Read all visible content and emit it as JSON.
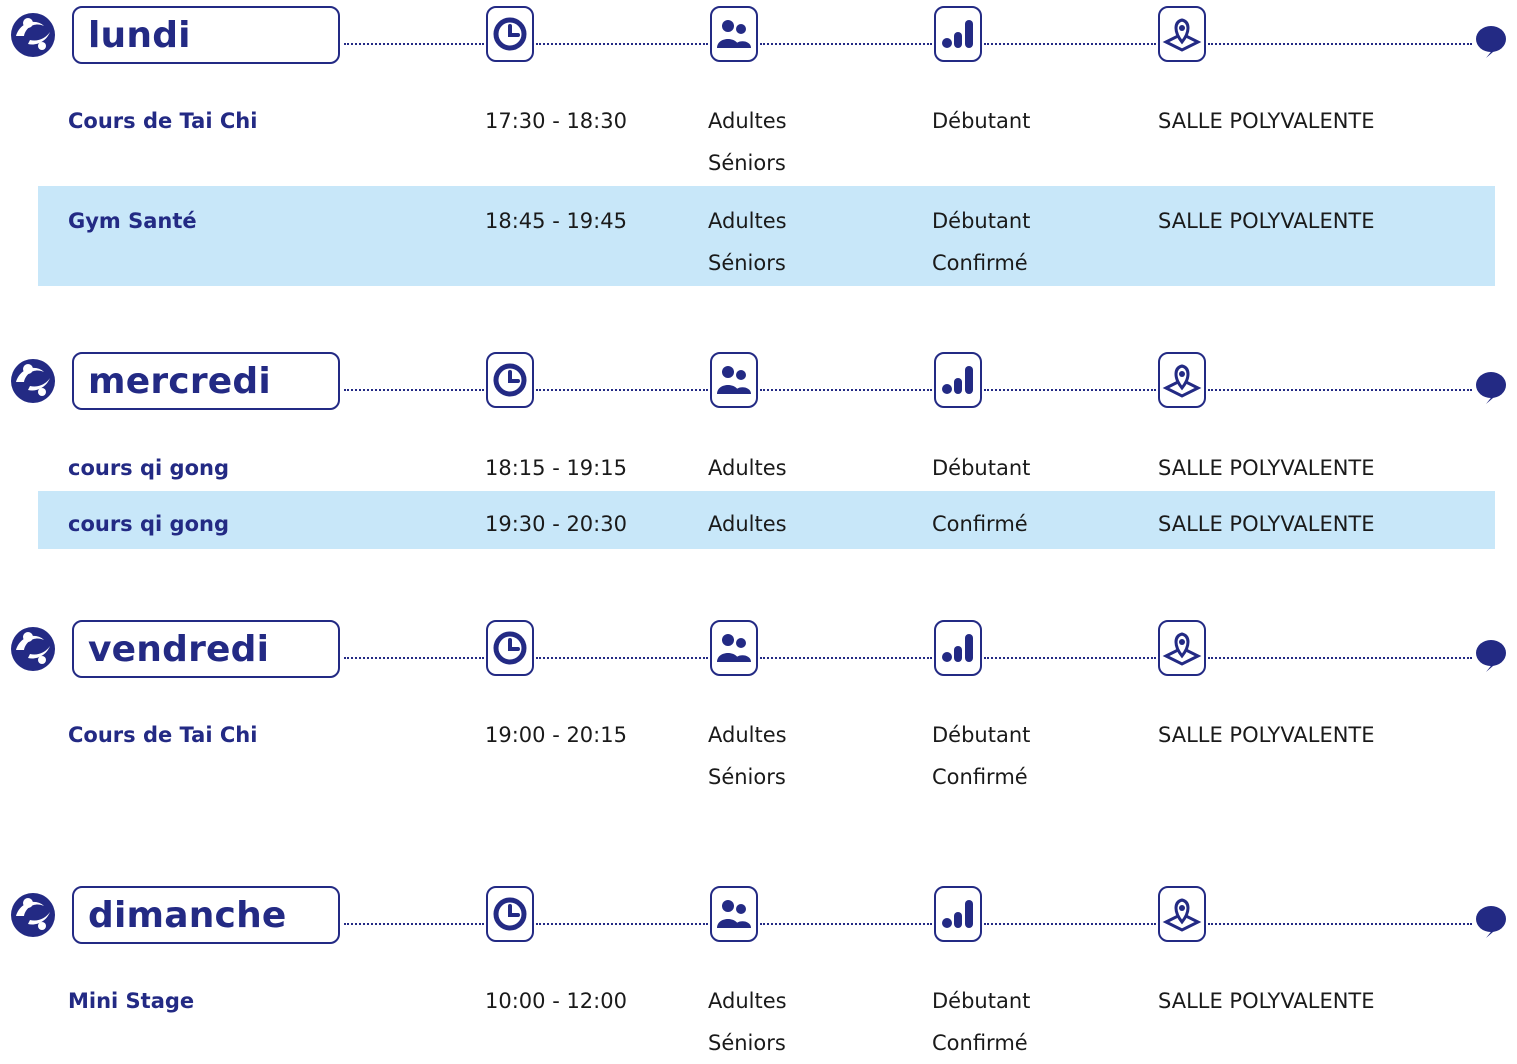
{
  "days": [
    {
      "name": "lundi",
      "sessions": [
        {
          "title": "Cours de Tai Chi",
          "time": "17:30 - 18:30",
          "public": [
            "Adultes",
            "Séniors"
          ],
          "level": [
            "Débutant"
          ],
          "location": "SALLE POLYVALENTE"
        },
        {
          "title": "Gym Santé",
          "time": "18:45 - 19:45",
          "public": [
            "Adultes",
            "Séniors"
          ],
          "level": [
            "Débutant",
            "Confirmé"
          ],
          "location": "SALLE POLYVALENTE"
        }
      ]
    },
    {
      "name": "mercredi",
      "sessions": [
        {
          "title": "cours qi gong",
          "time": "18:15 - 19:15",
          "public": [
            "Adultes"
          ],
          "level": [
            "Débutant"
          ],
          "location": "SALLE POLYVALENTE"
        },
        {
          "title": "cours qi gong",
          "time": "19:30 - 20:30",
          "public": [
            "Adultes"
          ],
          "level": [
            "Confirmé"
          ],
          "location": "SALLE POLYVALENTE"
        }
      ]
    },
    {
      "name": "vendredi",
      "sessions": [
        {
          "title": "Cours de Tai Chi",
          "time": "19:00 - 20:15",
          "public": [
            "Adultes",
            "Séniors"
          ],
          "level": [
            "Débutant",
            "Confirmé"
          ],
          "location": "SALLE POLYVALENTE"
        }
      ]
    },
    {
      "name": "dimanche",
      "sessions": [
        {
          "title": "Mini Stage",
          "time": "10:00 - 12:00",
          "public": [
            "Adultes",
            "Séniors"
          ],
          "level": [
            "Débutant",
            "Confirmé"
          ],
          "location": "SALLE POLYVALENTE"
        }
      ]
    }
  ],
  "icons": {
    "logo": "club-logo-icon",
    "time": "clock-icon",
    "public": "people-icon",
    "level": "level-bars-icon",
    "location": "map-pin-icon",
    "comment": "speech-bubble-icon"
  },
  "colors": {
    "accent": "#232a84",
    "row_highlight": "#c8e7f9",
    "text": "#1a1a1a"
  }
}
